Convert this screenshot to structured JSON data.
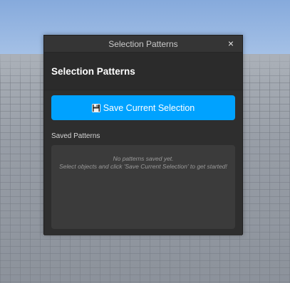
{
  "window": {
    "title": "Selection Patterns",
    "close_label": "×"
  },
  "panel": {
    "heading": "Selection Patterns",
    "save_button_label": "Save Current Selection",
    "save_button_icon": "floppy-disk-icon",
    "saved_section_label": "Saved Patterns",
    "empty_line1": "No patterns saved yet.",
    "empty_line2": "Select objects and click 'Save Current Selection' to get started!"
  },
  "colors": {
    "accent": "#00a2ff",
    "window_bg": "#2e2e2e",
    "list_bg": "#3b3b3b"
  }
}
